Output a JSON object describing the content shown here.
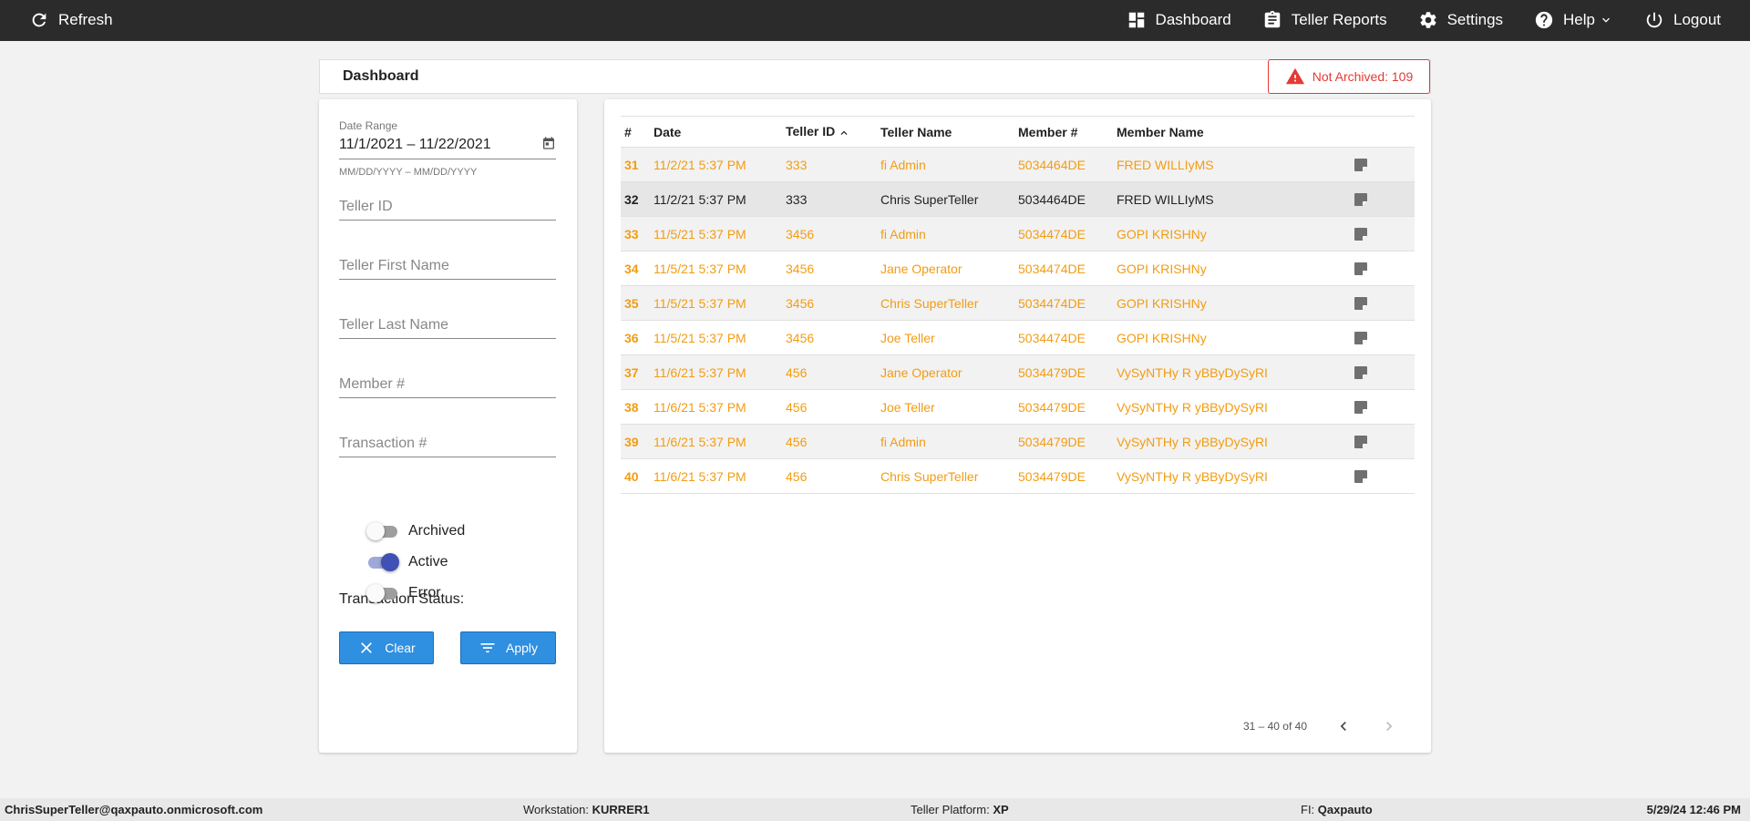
{
  "topbar": {
    "refresh_label": "Refresh",
    "nav": [
      {
        "label": "Dashboard",
        "icon": "dashboard-icon"
      },
      {
        "label": "Teller Reports",
        "icon": "clipboard-icon"
      },
      {
        "label": "Settings",
        "icon": "gear-icon"
      },
      {
        "label": "Help",
        "icon": "help-icon"
      },
      {
        "label": "Logout",
        "icon": "power-icon"
      }
    ]
  },
  "header": {
    "title": "Dashboard",
    "not_archived": "Not Archived: 109"
  },
  "filters": {
    "date_range_label": "Date Range",
    "date_range_value": "11/1/2021 – 11/22/2021",
    "date_range_hint": "MM/DD/YYYY – MM/DD/YYYY",
    "teller_id_placeholder": "Teller ID",
    "teller_first_name_placeholder": "Teller First Name",
    "teller_last_name_placeholder": "Teller Last Name",
    "member_num_placeholder": "Member #",
    "transaction_num_placeholder": "Transaction #",
    "status_label": "Transaction Status:",
    "toggles": [
      {
        "label": "Archived",
        "on": false
      },
      {
        "label": "Active",
        "on": true
      },
      {
        "label": "Error",
        "on": false
      }
    ],
    "clear_label": "Clear",
    "apply_label": "Apply"
  },
  "table": {
    "columns": [
      "#",
      "Date",
      "Teller ID",
      "Teller Name",
      "Member #",
      "Member Name"
    ],
    "rows": [
      {
        "num": "31",
        "date": "11/2/21 5:37 PM",
        "teller_id": "333",
        "teller_name": "fi Admin",
        "member_num": "5034464DE",
        "member_name": "FRED WILLIyMS"
      },
      {
        "num": "32",
        "date": "11/2/21 5:37 PM",
        "teller_id": "333",
        "teller_name": "Chris SuperTeller",
        "member_num": "5034464DE",
        "member_name": "FRED WILLIyMS"
      },
      {
        "num": "33",
        "date": "11/5/21 5:37 PM",
        "teller_id": "3456",
        "teller_name": "fi Admin",
        "member_num": "5034474DE",
        "member_name": "GOPI KRISHNy"
      },
      {
        "num": "34",
        "date": "11/5/21 5:37 PM",
        "teller_id": "3456",
        "teller_name": "Jane Operator",
        "member_num": "5034474DE",
        "member_name": "GOPI KRISHNy"
      },
      {
        "num": "35",
        "date": "11/5/21 5:37 PM",
        "teller_id": "3456",
        "teller_name": "Chris SuperTeller",
        "member_num": "5034474DE",
        "member_name": "GOPI KRISHNy"
      },
      {
        "num": "36",
        "date": "11/5/21 5:37 PM",
        "teller_id": "3456",
        "teller_name": "Joe Teller",
        "member_num": "5034474DE",
        "member_name": "GOPI KRISHNy"
      },
      {
        "num": "37",
        "date": "11/6/21 5:37 PM",
        "teller_id": "456",
        "teller_name": "Jane Operator",
        "member_num": "5034479DE",
        "member_name": "VySyNTHy R yBByDySyRI"
      },
      {
        "num": "38",
        "date": "11/6/21 5:37 PM",
        "teller_id": "456",
        "teller_name": "Joe Teller",
        "member_num": "5034479DE",
        "member_name": "VySyNTHy R yBByDySyRI"
      },
      {
        "num": "39",
        "date": "11/6/21 5:37 PM",
        "teller_id": "456",
        "teller_name": "fi Admin",
        "member_num": "5034479DE",
        "member_name": "VySyNTHy R yBByDySyRI"
      },
      {
        "num": "40",
        "date": "11/6/21 5:37 PM",
        "teller_id": "456",
        "teller_name": "Chris SuperTeller",
        "member_num": "5034479DE",
        "member_name": "VySyNTHy R yBByDySyRI"
      }
    ],
    "paging": "31 – 40 of 40"
  },
  "footer": {
    "user": "ChrisSuperTeller@qaxpauto.onmicrosoft.com",
    "workstation_label": "Workstation:",
    "workstation": "KURRER1",
    "platform_label": "Teller Platform:",
    "platform": "XP",
    "fi_label": "FI:",
    "fi": "Qaxpauto",
    "datetime": "5/29/24 12:46 PM"
  },
  "colors": {
    "accent_orange": "#f39c12",
    "alert_red": "#e53935",
    "button_blue": "#2f8fe0",
    "toggle_on": "#3f51b5"
  }
}
